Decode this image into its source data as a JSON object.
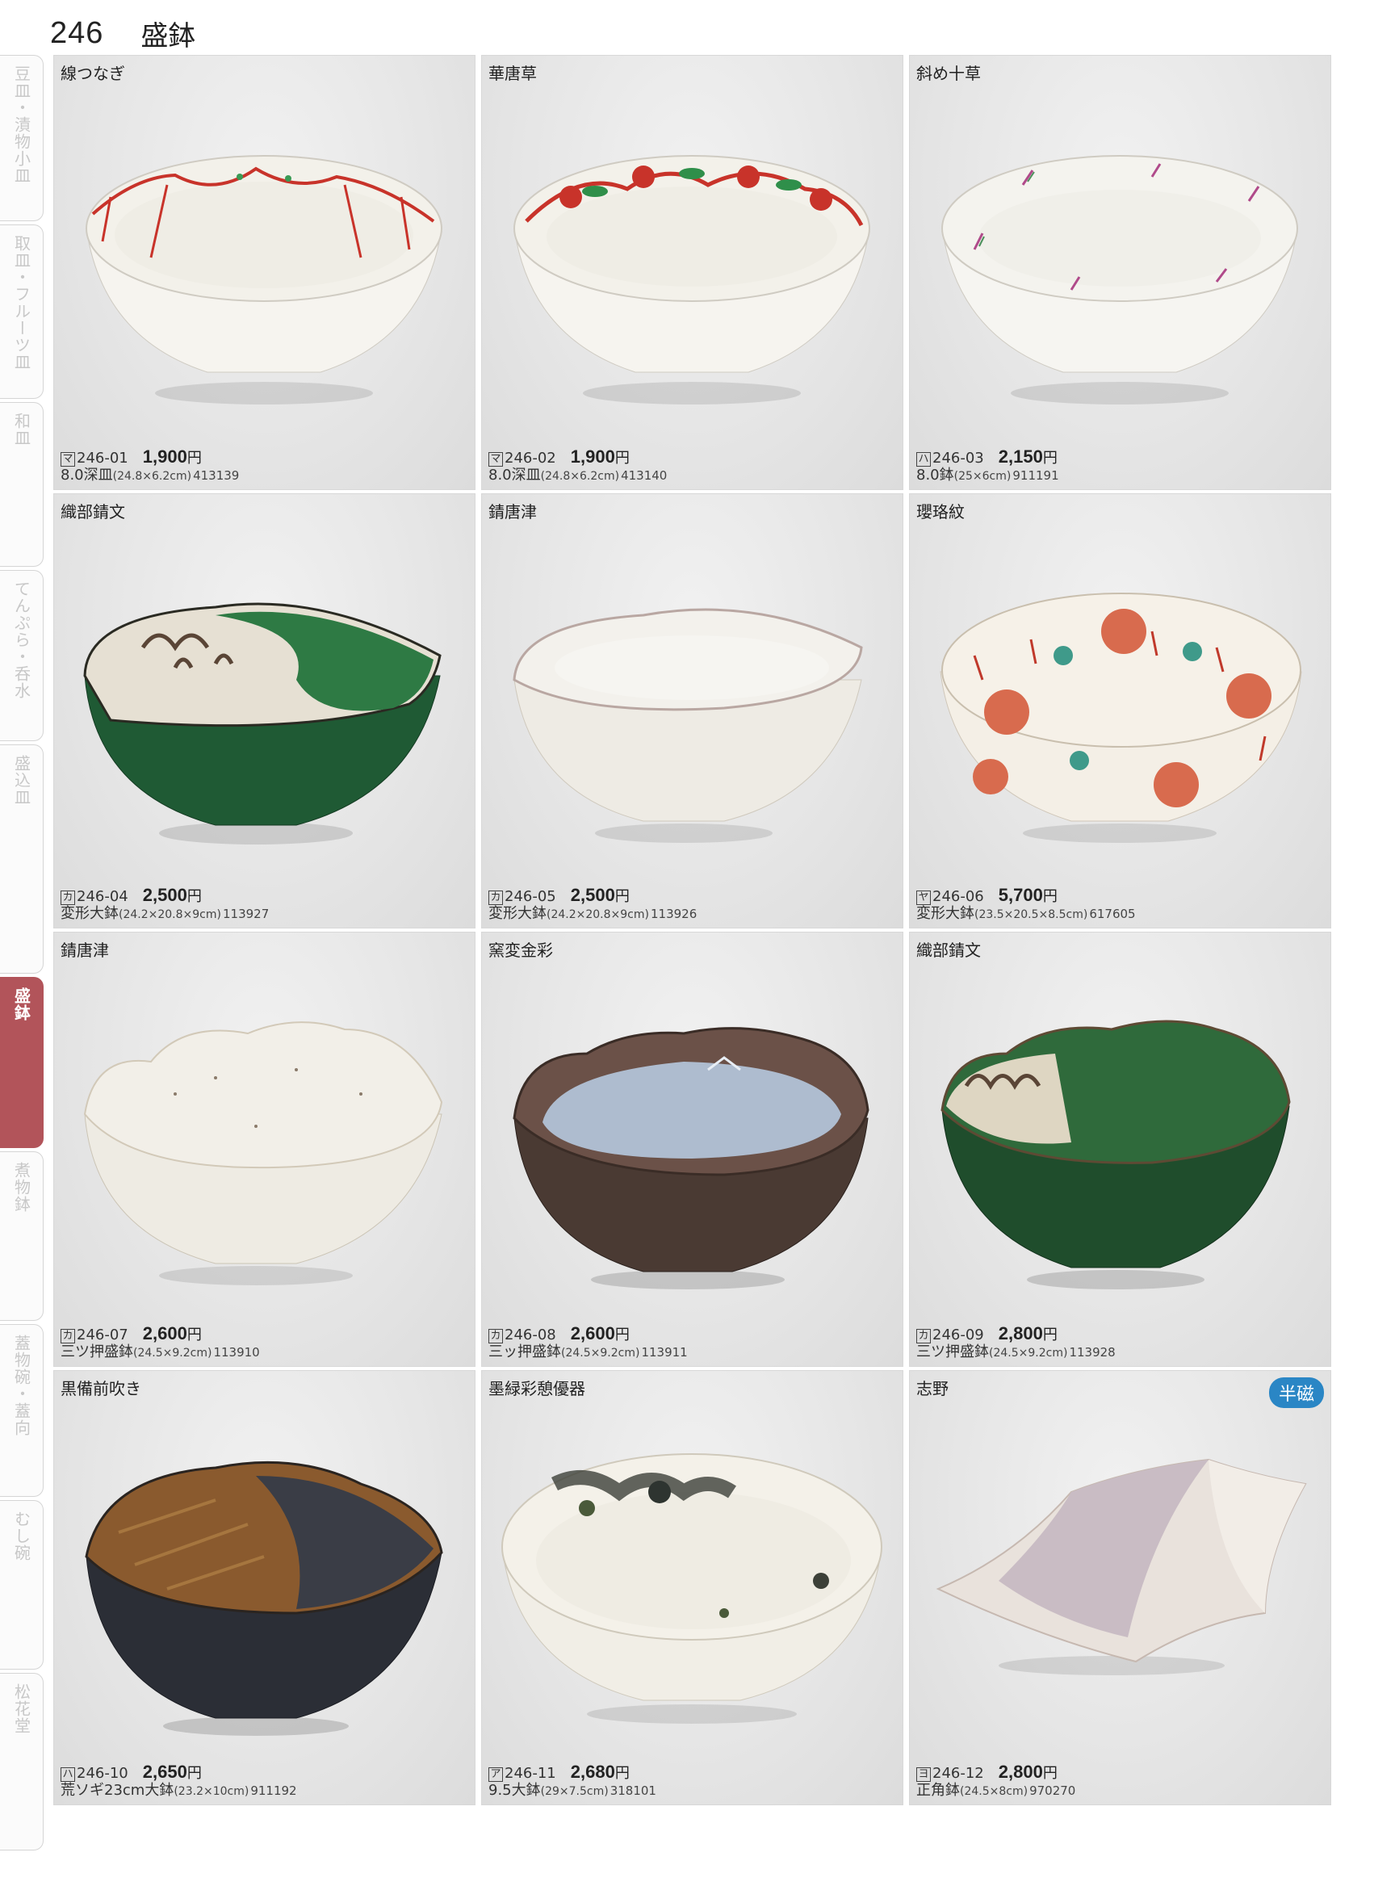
{
  "page": {
    "number": "246",
    "category": "盛鉢"
  },
  "side_tabs": [
    {
      "label": "豆皿・漬物小皿"
    },
    {
      "label": "取皿・フルーツ皿"
    },
    {
      "label": "和皿"
    },
    {
      "label": "てんぷら・呑水"
    },
    {
      "label": "盛込皿"
    },
    {
      "label": "盛鉢"
    },
    {
      "label": "煮物鉢"
    },
    {
      "label": "蓋物碗・蓋向"
    },
    {
      "label": "むし碗"
    },
    {
      "label": "松花堂"
    }
  ],
  "products": [
    {
      "title": "線つなぎ",
      "mark": "マ",
      "code": "246-01",
      "price": "1,900",
      "currency": "円",
      "name": "8.0深皿",
      "dims": "(24.8×6.2cm)",
      "jan": "413139",
      "badge": "",
      "image": "white-bowl-red-line-pattern"
    },
    {
      "title": "華唐草",
      "mark": "マ",
      "code": "246-02",
      "price": "1,900",
      "currency": "円",
      "name": "8.0深皿",
      "dims": "(24.8×6.2cm)",
      "jan": "413140",
      "badge": "",
      "image": "white-bowl-red-green-arabesque"
    },
    {
      "title": "斜め十草",
      "mark": "ハ",
      "code": "246-03",
      "price": "2,150",
      "currency": "円",
      "name": "8.0鉢",
      "dims": "(25×6cm)",
      "jan": "911191",
      "badge": "",
      "image": "white-bowl-diagonal-strokes"
    },
    {
      "title": "織部錆文",
      "mark": "カ",
      "code": "246-04",
      "price": "2,500",
      "currency": "円",
      "name": "変形大鉢",
      "dims": "(24.2×20.8×9cm)",
      "jan": "113927",
      "badge": "",
      "image": "green-oribe-bowl"
    },
    {
      "title": "錆唐津",
      "mark": "カ",
      "code": "246-05",
      "price": "2,500",
      "currency": "円",
      "name": "変形大鉢",
      "dims": "(24.2×20.8×9cm)",
      "jan": "113926",
      "badge": "",
      "image": "white-karatsu-bowl"
    },
    {
      "title": "瓔珞紋",
      "mark": "ヤ",
      "code": "246-06",
      "price": "5,700",
      "currency": "円",
      "name": "変形大鉢",
      "dims": "(23.5×20.5×8.5cm)",
      "jan": "617605",
      "badge": "",
      "image": "red-floral-pattern-bowl"
    },
    {
      "title": "錆唐津",
      "mark": "カ",
      "code": "246-07",
      "price": "2,600",
      "currency": "円",
      "name": "三ツ押盛鉢",
      "dims": "(24.5×9.2cm)",
      "jan": "113910",
      "badge": "",
      "image": "white-scalloped-bowl"
    },
    {
      "title": "窯変金彩",
      "mark": "カ",
      "code": "246-08",
      "price": "2,600",
      "currency": "円",
      "name": "三ッ押盛鉢",
      "dims": "(24.5×9.2cm)",
      "jan": "113911",
      "badge": "",
      "image": "brown-blue-glaze-bowl"
    },
    {
      "title": "織部錆文",
      "mark": "カ",
      "code": "246-09",
      "price": "2,800",
      "currency": "円",
      "name": "三ツ押盛鉢",
      "dims": "(24.5×9.2cm)",
      "jan": "113928",
      "badge": "",
      "image": "green-oribe-scalloped-bowl"
    },
    {
      "title": "黒備前吹き",
      "mark": "ハ",
      "code": "246-10",
      "price": "2,650",
      "currency": "円",
      "name": "荒ソギ23cm大鉢",
      "dims": "(23.2×10cm)",
      "jan": "911192",
      "badge": "",
      "image": "bizen-black-brown-bowl"
    },
    {
      "title": "墨緑彩憩優器",
      "mark": "ア",
      "code": "246-11",
      "price": "2,680",
      "currency": "円",
      "name": "9.5大鉢",
      "dims": "(29×7.5cm)",
      "jan": "318101",
      "badge": "",
      "image": "white-ink-splash-bowl"
    },
    {
      "title": "志野",
      "mark": "ヨ",
      "code": "246-12",
      "price": "2,800",
      "currency": "円",
      "name": "正角鉢",
      "dims": "(24.5×8cm)",
      "jan": "970270",
      "badge": "半磁",
      "image": "shino-square-bowl"
    }
  ]
}
